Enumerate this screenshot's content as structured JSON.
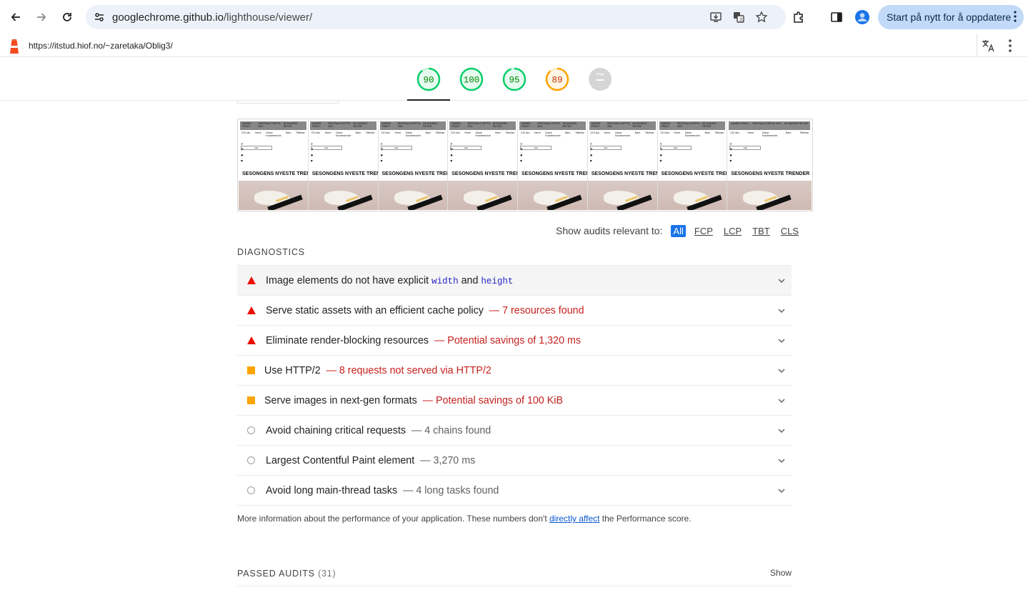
{
  "browser": {
    "url_host": "googlechrome.github.io",
    "url_path": "/lighthouse/viewer/",
    "update_button_label": "Start på nytt for å oppdatere"
  },
  "lighthouse": {
    "tested_url": "https://itstud.hiof.no/~zaretaka/Oblig3/"
  },
  "scores": [
    {
      "value": "90",
      "color": "#0cce6b",
      "text_color": "#008800",
      "fraction": 0.9
    },
    {
      "value": "100",
      "color": "#0cce6b",
      "text_color": "#008800",
      "fraction": 1.0
    },
    {
      "value": "95",
      "color": "#0cce6b",
      "text_color": "#008800",
      "fraction": 0.95
    },
    {
      "value": "89",
      "color": "#ffa400",
      "text_color": "#c33300",
      "fraction": 0.89
    },
    {
      "value": "PWA",
      "color": "#d5d5d5",
      "text_color": "#ffffff",
      "fraction": 0
    }
  ],
  "filmstrip": {
    "frame_title": "SESONGENS NYESTE TRENDER",
    "header_left": "DAMER FRAKT",
    "header_mid": "RESTSALG OPPTIL 40%",
    "header_right": "60 DAGERS RETUR",
    "nav_left": "Z10 sko",
    "nav_mid": "Herre",
    "nav_right": "Dame",
    "nav_far": "Barn",
    "nav_end": "Tilbehør",
    "nav_sub": "Kundeservice",
    "search_placeholder": "Søk"
  },
  "filter": {
    "label": "Show audits relevant to:",
    "chips": [
      "All",
      "FCP",
      "LCP",
      "TBT",
      "CLS"
    ]
  },
  "diagnostics": {
    "title": "DIAGNOSTICS",
    "audits": [
      {
        "icon": "fail-triangle",
        "title": "Image elements do not have explicit",
        "code1": "width",
        "and": "and",
        "code2": "height",
        "display": ""
      },
      {
        "icon": "fail-triangle",
        "title": "Serve static assets with an efficient cache policy",
        "display": "— 7 resources found"
      },
      {
        "icon": "fail-triangle",
        "title": "Eliminate render-blocking resources",
        "display": "— Potential savings of 1,320 ms"
      },
      {
        "icon": "average-square",
        "title": "Use HTTP/2",
        "display": "— 8 requests not served via HTTP/2"
      },
      {
        "icon": "average-square",
        "title": "Serve images in next-gen formats",
        "display": "— Potential savings of 100 KiB"
      },
      {
        "icon": "info-circle",
        "title": "Avoid chaining critical requests",
        "display": "— 4 chains found"
      },
      {
        "icon": "info-circle",
        "title": "Largest Contentful Paint element",
        "display": "— 3,270 ms"
      },
      {
        "icon": "info-circle",
        "title": "Avoid long main-thread tasks",
        "display": "— 4 long tasks found"
      }
    ],
    "more_info_before": "More information about the performance of your application. These numbers don't ",
    "more_info_link": "directly affect",
    "more_info_after": " the Performance score."
  },
  "passed": {
    "title": "PASSED AUDITS",
    "count": "(31)",
    "show_label": "Show"
  }
}
